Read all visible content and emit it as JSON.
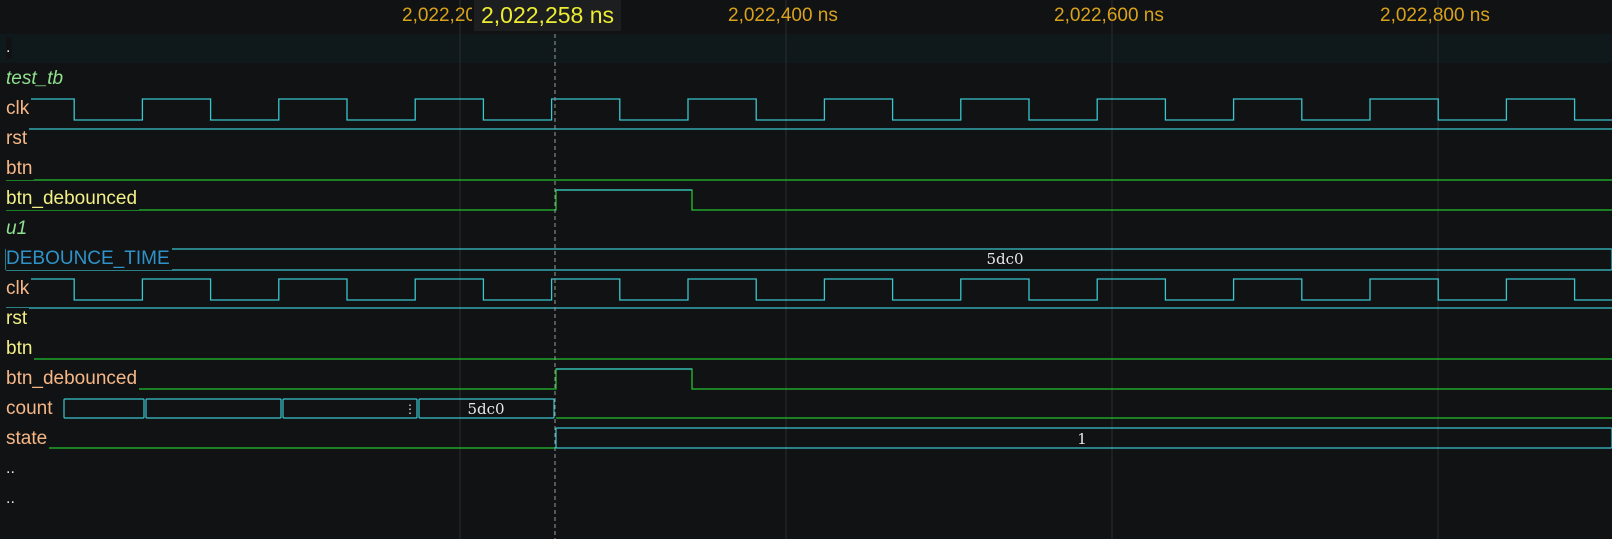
{
  "timeline": {
    "ticks": [
      "2,022,200 ns",
      "2,022,400 ns",
      "2,022,600 ns",
      "2,022,800 ns"
    ],
    "cursor": "2,022,258 ns"
  },
  "signals": [
    {
      "label": "."
    },
    {
      "label": "test_tb"
    },
    {
      "label": "clk"
    },
    {
      "label": "rst"
    },
    {
      "label": "btn"
    },
    {
      "label": "btn_debounced"
    },
    {
      "label": "u1"
    },
    {
      "label": "DEBOUNCE_TIME"
    },
    {
      "label": "clk"
    },
    {
      "label": "rst"
    },
    {
      "label": "btn"
    },
    {
      "label": "btn_debounced"
    },
    {
      "label": "count"
    },
    {
      "label": "state"
    },
    {
      "label": ".."
    },
    {
      "label": ".."
    }
  ],
  "values": {
    "debounce_time": "5dc0",
    "count": "5dc0",
    "count_overflow": "⋮",
    "state": "1"
  },
  "colors": {
    "low": "#22c22e",
    "high": "#39c6cf",
    "bus": "#39c6cf",
    "cursor": "#a0a0a0",
    "grid": "#2a2c2e"
  }
}
